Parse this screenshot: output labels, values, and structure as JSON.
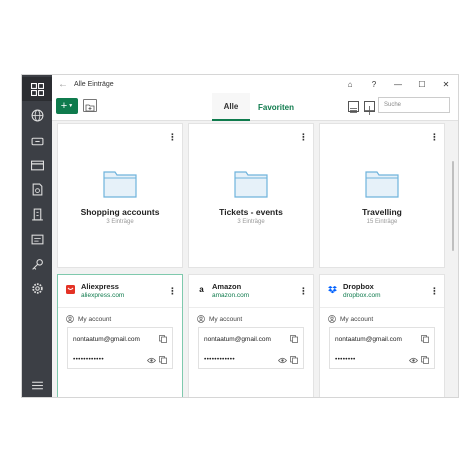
{
  "window": {
    "title": "Alle Einträge",
    "controls": [
      "⌂",
      "?",
      "—",
      "☐",
      "✕"
    ]
  },
  "toolbar": {
    "add_label": "+",
    "tabs": [
      "Alle",
      "Favoriten"
    ],
    "active_tab": "Alle",
    "search_placeholder": "Suche"
  },
  "sidebar": {
    "items": [
      "overview-icon",
      "web-icon",
      "bank-card-icon",
      "id-card-icon",
      "document-icon",
      "building-icon",
      "note-icon",
      "key-icon",
      "settings-icon"
    ],
    "bottom": "menu-icon"
  },
  "folders": [
    {
      "title": "Shopping accounts",
      "count": "3 Einträge"
    },
    {
      "title": "Tickets - events",
      "count": "3 Einträge"
    },
    {
      "title": "Travelling",
      "count": "15 Einträge"
    }
  ],
  "entries": [
    {
      "name": "Aliexpress",
      "url": "aliexpress.com",
      "account_label": "My account",
      "username": "nontaatum@gmail.com",
      "password": "••••••••••••",
      "brand_color": "#e43225",
      "brand_icon": "aliexpress-icon"
    },
    {
      "name": "Amazon",
      "url": "amazon.com",
      "account_label": "My account",
      "username": "nontaatum@gmail.com",
      "password": "••••••••••••",
      "brand_color": "#111111",
      "brand_icon": "amazon-icon"
    },
    {
      "name": "Dropbox",
      "url": "dropbox.com",
      "account_label": "My account",
      "username": "nontaatum@gmail.com",
      "password": "••••••••",
      "brand_color": "#0061fe",
      "brand_icon": "dropbox-icon"
    }
  ],
  "colors": {
    "accent": "#0f7b4d",
    "sidebar": "#3c3f45",
    "folder": "#6fb3dc"
  }
}
